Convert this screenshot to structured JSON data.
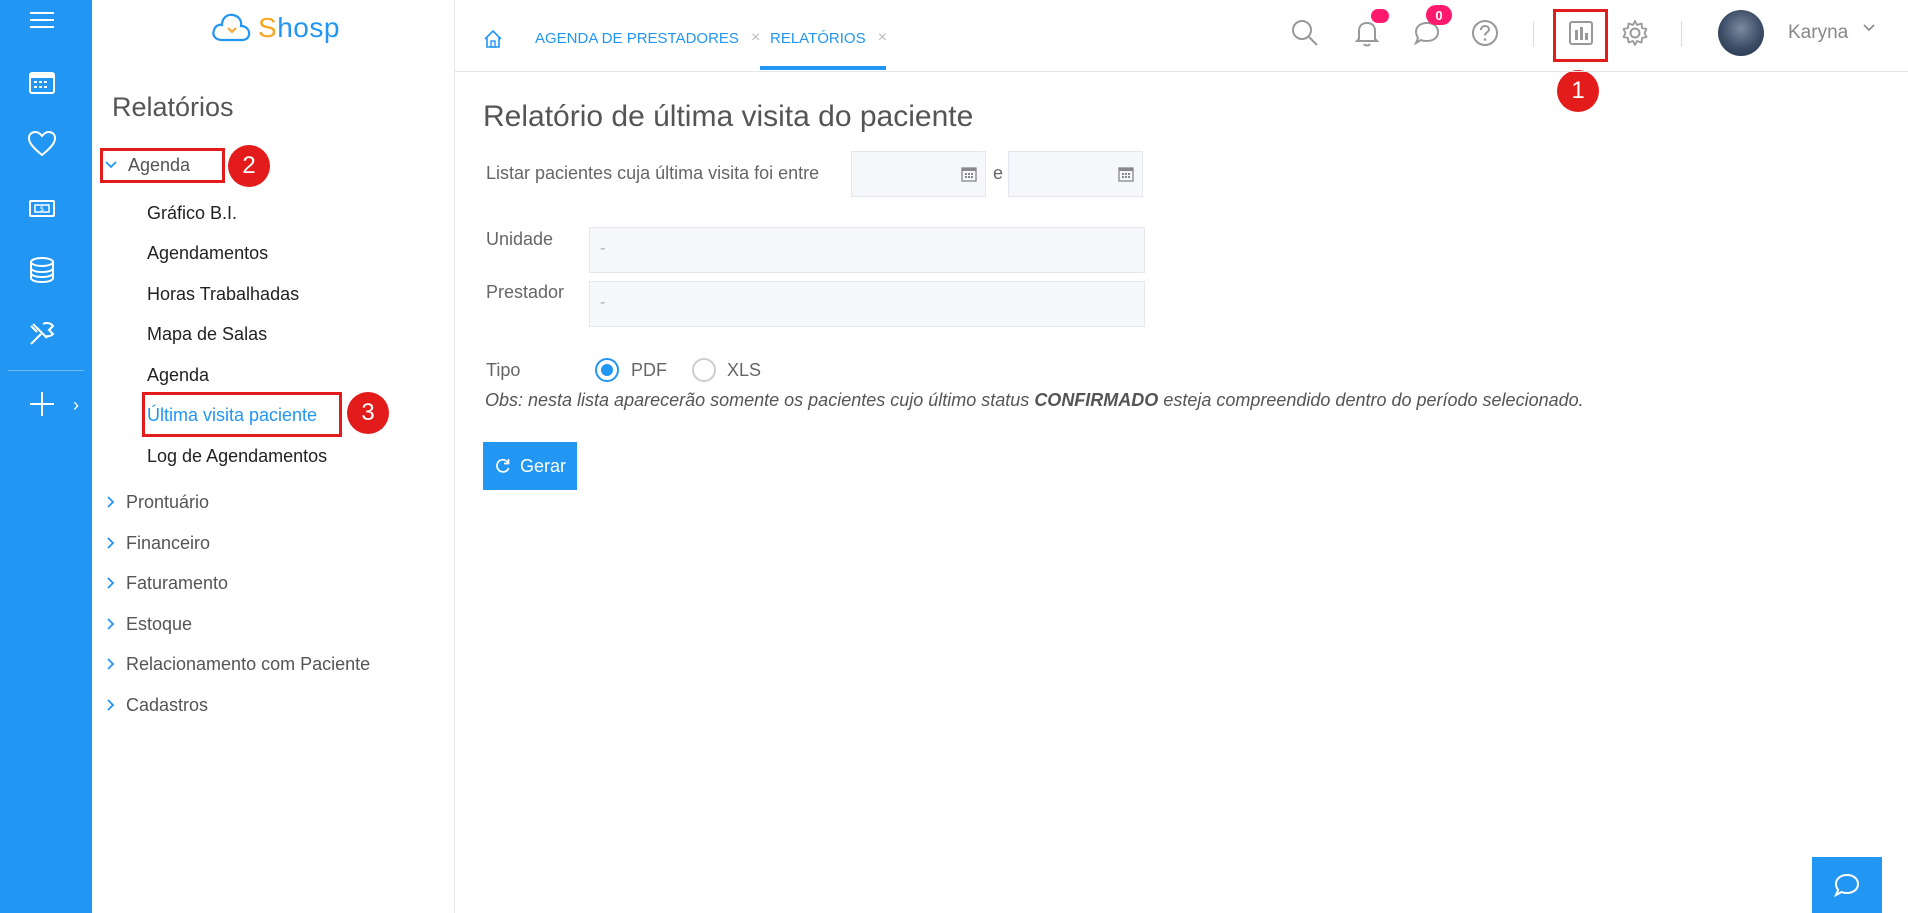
{
  "app": {
    "logo_text": "Shosp"
  },
  "rail": {
    "icons": [
      "menu-icon",
      "calendar-icon",
      "heart-icon",
      "money-icon",
      "database-icon",
      "tools-icon",
      "plus-icon"
    ]
  },
  "sidebar": {
    "title": "Relatórios",
    "sections": [
      {
        "label": "Agenda",
        "expanded": true
      },
      {
        "label": "Prontuário"
      },
      {
        "label": "Financeiro"
      },
      {
        "label": "Faturamento"
      },
      {
        "label": "Estoque"
      },
      {
        "label": "Relacionamento com Paciente"
      },
      {
        "label": "Cadastros"
      }
    ],
    "agenda_items": [
      "Gráfico B.I.",
      "Agendamentos",
      "Horas Trabalhadas",
      "Mapa de Salas",
      "Agenda",
      "Última visita paciente",
      "Log de Agendamentos"
    ]
  },
  "tabs": [
    {
      "label": "AGENDA DE PRESTADORES",
      "close": "×"
    },
    {
      "label": "RELATÓRIOS",
      "close": "×"
    }
  ],
  "topbar": {
    "message_count": "0",
    "username": "Karyna"
  },
  "annotations": [
    "1",
    "2",
    "3"
  ],
  "main": {
    "title": "Relatório de última visita do paciente",
    "list_label": "Listar pacientes cuja última visita foi entre",
    "conj": "e",
    "unidade_label": "Unidade",
    "unidade_value": "-",
    "prestador_label": "Prestador",
    "prestador_value": "-",
    "tipo_label": "Tipo",
    "tipo_options": [
      "PDF",
      "XLS"
    ],
    "obs_prefix": "Obs: nesta lista aparecerão somente os pacientes cujo último status",
    "obs_bold": "CONFIRMADO",
    "obs_suffix": "esteja compreendido dentro do período selecionado.",
    "button_label": "Gerar"
  },
  "colors": {
    "primary": "#2196f3",
    "annotation": "#e31b1b",
    "notification": "#ff1a6e"
  }
}
